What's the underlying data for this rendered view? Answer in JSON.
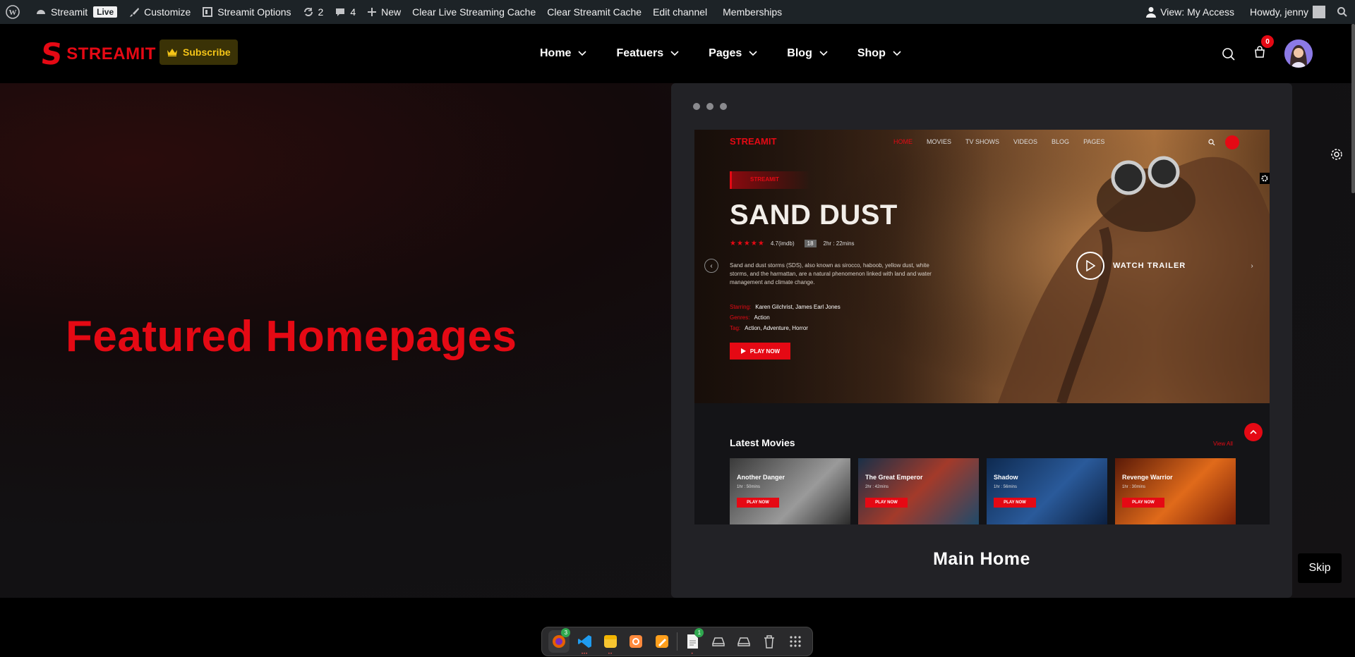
{
  "adminbar": {
    "site_name": "Streamit",
    "live_badge": "Live",
    "customize": "Customize",
    "options": "Streamit Options",
    "updates_count": "2",
    "comments_count": "4",
    "new_label": "New",
    "clear_live_cache": "Clear Live Streaming Cache",
    "clear_cache": "Clear Streamit Cache",
    "edit_channel": "Edit channel",
    "memberships": "Memberships",
    "view_access": "View: My Access",
    "howdy": "Howdy, jenny"
  },
  "header": {
    "logo_letter": "S",
    "logo_text": "STREAMIT",
    "subscribe": "Subscribe",
    "nav": [
      "Home",
      "Featuers",
      "Pages",
      "Blog",
      "Shop"
    ],
    "cart_count": "0"
  },
  "hero": {
    "title": "Featured Homepages"
  },
  "card": {
    "label": "Main Home",
    "preview": {
      "logo": "STREAMIT",
      "nav": [
        "HOME",
        "MOVIES",
        "TV SHOWS",
        "VIDEOS",
        "BLOG",
        "PAGES"
      ],
      "tag": "STREAMIT",
      "movie_title": "SAND DUST",
      "rating": "4.7(imdb)",
      "age": "18",
      "duration": "2hr : 22mins",
      "description": "Sand and dust storms (SDS), also known as sirocco, haboob, yellow dust, white storms, and the harmattan, are a natural phenomenon linked with land and water management and climate change.",
      "starring_label": "Starring:",
      "starring": "Karen Gilchrist, James Earl Jones",
      "genres_label": "Genres:",
      "genres": "Action",
      "tag_label": "Tag:",
      "tags": "Action, Adventure, Horror",
      "play_now": "PLAY NOW",
      "watch_trailer": "WATCH TRAILER",
      "latest_movies": "Latest Movies",
      "view_all": "View All",
      "movies": [
        {
          "name": "Another Danger",
          "time": "1hr : 50mins",
          "play": "PLAY NOW",
          "color": "#4a4a4a"
        },
        {
          "name": "The Great Emperor",
          "time": "2hr : 42mins",
          "play": "PLAY NOW",
          "color": "#1f4a6a"
        },
        {
          "name": "Shadow",
          "time": "1hr : 56mins",
          "play": "PLAY NOW",
          "color": "#15427a"
        },
        {
          "name": "Revenge Warrior",
          "time": "1hr : 30mins",
          "play": "PLAY NOW",
          "color": "#8a2a10"
        }
      ]
    }
  },
  "skip": "Skip",
  "dock": {
    "badge_first": "3",
    "badge_notes": "1"
  },
  "colors": {
    "accent": "#e50914",
    "admin_bar": "#1d2327",
    "card": "#222226"
  }
}
